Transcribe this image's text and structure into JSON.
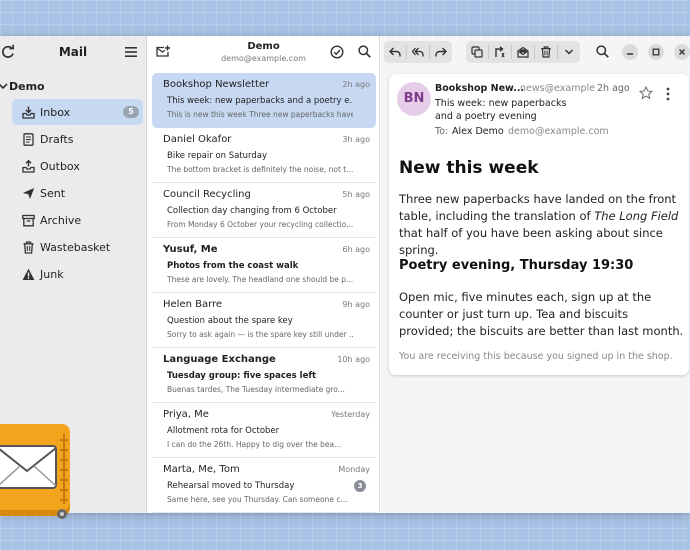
{
  "sidebar": {
    "title": "Mail",
    "account": "Demo",
    "folders": [
      {
        "label": "Inbox",
        "badge": "5",
        "icon": "inbox-icon"
      },
      {
        "label": "Drafts",
        "icon": "drafts-icon"
      },
      {
        "label": "Outbox",
        "icon": "outbox-icon"
      },
      {
        "label": "Sent",
        "icon": "sent-icon"
      },
      {
        "label": "Archive",
        "icon": "archive-icon"
      },
      {
        "label": "Wastebasket",
        "icon": "trash-icon"
      },
      {
        "label": "Junk",
        "icon": "junk-icon"
      }
    ]
  },
  "list": {
    "title": "Demo",
    "subtitle": "demo@example.com",
    "messages": [
      {
        "from": "Bookshop Newsletter",
        "time": "2h ago",
        "subject": "This week: new paperbacks and a poetry e...",
        "preview": "This is new this week Three new paperbacks have land...",
        "unread": false
      },
      {
        "from": "Daniel Okafor",
        "time": "3h ago",
        "subject": "Bike repair on Saturday",
        "preview": "The bottom bracket is definitely the noise, not t...",
        "unread": false
      },
      {
        "from": "Council Recycling",
        "time": "5h ago",
        "subject": "Collection day changing from 6 October",
        "preview": "From Monday 6 October your recycling collectio...",
        "unread": false
      },
      {
        "from": "Yusuf, Me",
        "time": "6h ago",
        "subject": "Photos from the coast walk",
        "preview": "These are lovely. The headland one should be p...",
        "unread": true
      },
      {
        "from": "Helen Barre",
        "time": "9h ago",
        "subject": "Question about the spare key",
        "preview": "Sorry to ask again — is the spare key still under ...",
        "unread": false
      },
      {
        "from": "Language Exchange",
        "time": "10h ago",
        "subject": "Tuesday group: five spaces left",
        "preview": "Buenas tardes, The Tuesday intermediate gro...",
        "unread": true
      },
      {
        "from": "Priya, Me",
        "time": "Yesterday",
        "subject": "Allotment rota for October",
        "preview": "I can do the 26th. Happy to dig over the bea...",
        "unread": false
      },
      {
        "from": "Marta, Me, Tom",
        "time": "Monday",
        "subject": "Rehearsal moved to Thursday",
        "preview": "Same here, see you Thursday. Can someone c...",
        "unread": false,
        "count": "3"
      }
    ]
  },
  "reader": {
    "avatar": "BN",
    "from": "Bookshop New...",
    "address": "news@example.com",
    "time": "2h ago",
    "subject": "This week: new paperbacks and a poetry evening",
    "to_label": "To:",
    "to_name": "Alex Demo",
    "to_address": "demo@example.com",
    "heading": "New this week",
    "para1_before": "Three new paperbacks have landed on the front table, including the translation of ",
    "para1_title": "The Long Field",
    "para1_after": " that half of you have been asking about since spring.",
    "heading2": "Poetry evening, Thursday 19:30",
    "para2": "Open mic, five minutes each, sign up at the counter or just turn up. Tea and biscuits provided; the biscuits are better than last month.",
    "footer": "You are receiving this because you signed up in the shop."
  },
  "colors": {
    "accent_selection": "#c6d8f2",
    "avatar_bg": "#e6cde9",
    "avatar_fg": "#7c3d8a",
    "desktop_bg": "#a9c3e6",
    "app_icon": "#f2a51c"
  }
}
